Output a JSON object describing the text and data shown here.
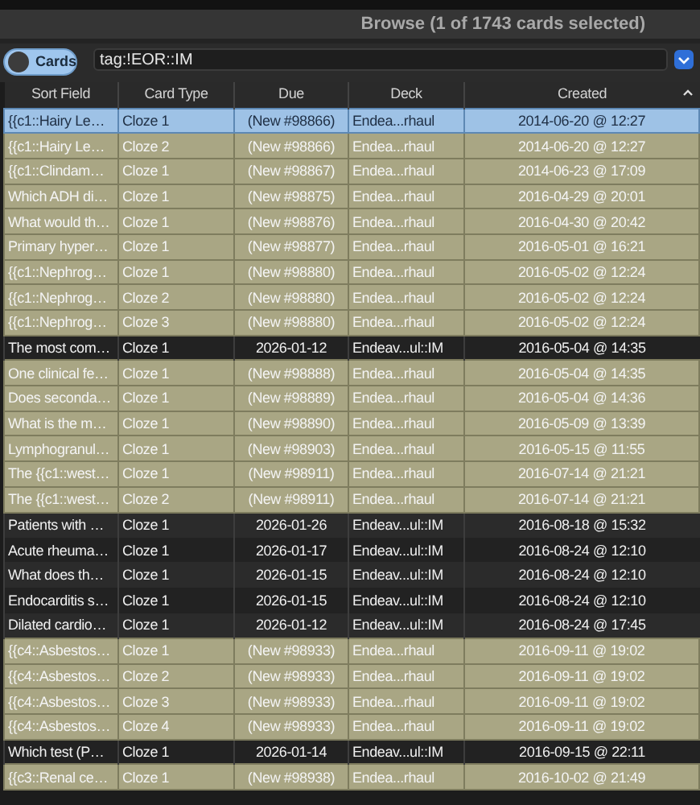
{
  "window": {
    "title": "Browse (1 of 1743 cards selected)"
  },
  "toolbar": {
    "mode_toggle": {
      "label": "Cards",
      "on": false
    },
    "search": {
      "value": "tag:!EOR::IM"
    }
  },
  "table": {
    "columns": [
      {
        "label": "Sort Field",
        "sorted": false
      },
      {
        "label": "Card Type",
        "sorted": false
      },
      {
        "label": "Due",
        "sorted": false
      },
      {
        "label": "Deck",
        "sorted": false
      },
      {
        "label": "Created",
        "sorted": true
      }
    ],
    "rows": [
      {
        "kind": "new",
        "selected": true,
        "cells": [
          "{{c1::Hairy Le…",
          "Cloze 1",
          "(New #98866)",
          "Endea...rhaul",
          "2014-06-20 @ 12:27"
        ]
      },
      {
        "kind": "new",
        "selected": false,
        "cells": [
          "{{c1::Hairy Le…",
          "Cloze 2",
          "(New #98866)",
          "Endea...rhaul",
          "2014-06-20 @ 12:27"
        ]
      },
      {
        "kind": "new",
        "selected": false,
        "cells": [
          "{{c1::Clindam…",
          "Cloze 1",
          "(New #98867)",
          "Endea...rhaul",
          "2014-06-23 @ 17:09"
        ]
      },
      {
        "kind": "new",
        "selected": false,
        "cells": [
          "Which ADH di…",
          "Cloze 1",
          "(New #98875)",
          "Endea...rhaul",
          "2016-04-29 @ 20:01"
        ]
      },
      {
        "kind": "new",
        "selected": false,
        "cells": [
          "What would th…",
          "Cloze 1",
          "(New #98876)",
          "Endea...rhaul",
          "2016-04-30 @ 20:42"
        ]
      },
      {
        "kind": "new",
        "selected": false,
        "cells": [
          "Primary hyper…",
          "Cloze 1",
          "(New #98877)",
          "Endea...rhaul",
          "2016-05-01 @ 16:21"
        ]
      },
      {
        "kind": "new",
        "selected": false,
        "cells": [
          "{{c1::Nephrog…",
          "Cloze 1",
          "(New #98880)",
          "Endea...rhaul",
          "2016-05-02 @ 12:24"
        ]
      },
      {
        "kind": "new",
        "selected": false,
        "cells": [
          "{{c1::Nephrog…",
          "Cloze 2",
          "(New #98880)",
          "Endea...rhaul",
          "2016-05-02 @ 12:24"
        ]
      },
      {
        "kind": "new",
        "selected": false,
        "cells": [
          "{{c1::Nephrog…",
          "Cloze 3",
          "(New #98880)",
          "Endea...rhaul",
          "2016-05-02 @ 12:24"
        ]
      },
      {
        "kind": "review",
        "selected": false,
        "cells": [
          "The most com…",
          "Cloze 1",
          "2026-01-12",
          "Endeav...ul::IM",
          "2016-05-04 @ 14:35"
        ]
      },
      {
        "kind": "new",
        "selected": false,
        "cells": [
          "One clinical fe…",
          "Cloze 1",
          "(New #98888)",
          "Endea...rhaul",
          "2016-05-04 @ 14:35"
        ]
      },
      {
        "kind": "new",
        "selected": false,
        "cells": [
          "Does seconda…",
          "Cloze 1",
          "(New #98889)",
          "Endea...rhaul",
          "2016-05-04 @ 14:36"
        ]
      },
      {
        "kind": "new",
        "selected": false,
        "cells": [
          "What is the m…",
          "Cloze 1",
          "(New #98890)",
          "Endea...rhaul",
          "2016-05-09 @ 13:39"
        ]
      },
      {
        "kind": "new",
        "selected": false,
        "cells": [
          "Lymphogranul…",
          "Cloze 1",
          "(New #98903)",
          "Endea...rhaul",
          "2016-05-15 @ 11:55"
        ]
      },
      {
        "kind": "new",
        "selected": false,
        "cells": [
          "The {{c1::west…",
          "Cloze 1",
          "(New #98911)",
          "Endea...rhaul",
          "2016-07-14 @ 21:21"
        ]
      },
      {
        "kind": "new",
        "selected": false,
        "cells": [
          "The {{c1::west…",
          "Cloze 2",
          "(New #98911)",
          "Endea...rhaul",
          "2016-07-14 @ 21:21"
        ]
      },
      {
        "kind": "review",
        "selected": false,
        "cells": [
          "Patients with …",
          "Cloze 1",
          "2026-01-26",
          "Endeav...ul::IM",
          "2016-08-18 @ 15:32"
        ]
      },
      {
        "kind": "review",
        "selected": false,
        "cells": [
          "Acute rheuma…",
          "Cloze 1",
          "2026-01-17",
          "Endeav...ul::IM",
          "2016-08-24 @ 12:10"
        ]
      },
      {
        "kind": "review",
        "selected": false,
        "cells": [
          "What does th…",
          "Cloze 1",
          "2026-01-15",
          "Endeav...ul::IM",
          "2016-08-24 @ 12:10"
        ]
      },
      {
        "kind": "review",
        "selected": false,
        "cells": [
          "Endocarditis s…",
          "Cloze 1",
          "2026-01-15",
          "Endeav...ul::IM",
          "2016-08-24 @ 12:10"
        ]
      },
      {
        "kind": "review",
        "selected": false,
        "cells": [
          "Dilated cardio…",
          "Cloze 1",
          "2026-01-12",
          "Endeav...ul::IM",
          "2016-08-24 @ 17:45"
        ]
      },
      {
        "kind": "new",
        "selected": false,
        "cells": [
          "{{c4::Asbestos…",
          "Cloze 1",
          "(New #98933)",
          "Endea...rhaul",
          "2016-09-11 @ 19:02"
        ]
      },
      {
        "kind": "new",
        "selected": false,
        "cells": [
          "{{c4::Asbestos…",
          "Cloze 2",
          "(New #98933)",
          "Endea...rhaul",
          "2016-09-11 @ 19:02"
        ]
      },
      {
        "kind": "new",
        "selected": false,
        "cells": [
          "{{c4::Asbestos…",
          "Cloze 3",
          "(New #98933)",
          "Endea...rhaul",
          "2016-09-11 @ 19:02"
        ]
      },
      {
        "kind": "new",
        "selected": false,
        "cells": [
          "{{c4::Asbestos…",
          "Cloze 4",
          "(New #98933)",
          "Endea...rhaul",
          "2016-09-11 @ 19:02"
        ]
      },
      {
        "kind": "review",
        "selected": false,
        "cells": [
          "Which test (P…",
          "Cloze 1",
          "2026-01-14",
          "Endeav...ul::IM",
          "2016-09-15 @ 22:11"
        ]
      },
      {
        "kind": "new",
        "selected": false,
        "cells": [
          "{{c3::Renal ce…",
          "Cloze 1",
          "(New #98938)",
          "Endea...rhaul",
          "2016-10-02 @ 21:49"
        ]
      }
    ]
  }
}
